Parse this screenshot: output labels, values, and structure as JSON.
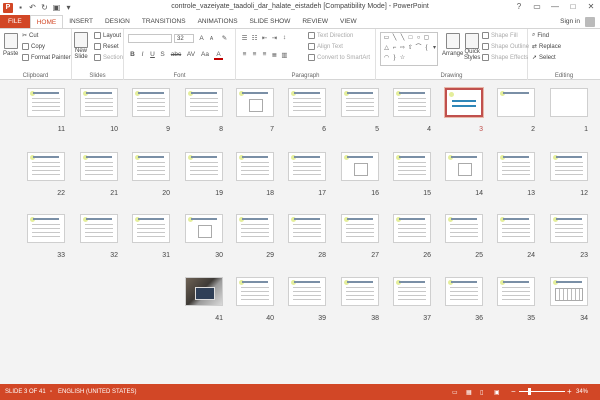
{
  "window": {
    "title": "controle_vazeiyate_taadoli_dar_halate_eistadeh [Compatibility Mode] - PowerPoint",
    "app_icon_letter": "P",
    "controls": [
      "?",
      "▭",
      "—",
      "□",
      "✕"
    ]
  },
  "tabs": [
    "FILE",
    "HOME",
    "INSERT",
    "DESIGN",
    "TRANSITIONS",
    "ANIMATIONS",
    "SLIDE SHOW",
    "REVIEW",
    "VIEW"
  ],
  "active_tab": "HOME",
  "account": {
    "signin": "Sign in"
  },
  "ribbon": {
    "clipboard": {
      "label": "Clipboard",
      "paste": "Paste",
      "cut": "Cut",
      "copy": "Copy",
      "format_painter": "Format Painter"
    },
    "slides": {
      "label": "Slides",
      "new_slide": "New",
      "new_slide_2": "Slide",
      "layout": "Layout",
      "reset": "Reset",
      "section": "Section"
    },
    "font": {
      "label": "Font",
      "font_size": "32",
      "grow": "A",
      "shrink": "A",
      "bold": "B",
      "italic": "I",
      "underline": "U",
      "strike": "S",
      "shadow": "abc",
      "spacing": "AV",
      "case": "Aa",
      "color": "A"
    },
    "paragraph": {
      "label": "Paragraph",
      "text_direction": "Text Direction",
      "align_text": "Align Text",
      "convert_smartart": "Convert to SmartArt"
    },
    "drawing": {
      "label": "Drawing",
      "arrange": "Arrange",
      "quick_styles": "Quick",
      "quick_styles_2": "Styles",
      "shape_fill": "Shape Fill",
      "shape_outline": "Shape Outline",
      "shape_effects": "Shape Effects"
    },
    "editing": {
      "label": "Editing",
      "find": "Find",
      "replace": "Replace",
      "select": "Select"
    }
  },
  "slides": [
    {
      "n": "1",
      "style": "blank"
    },
    {
      "n": "2",
      "style": "title"
    },
    {
      "n": "3",
      "style": "intro",
      "selected": true
    },
    {
      "n": "4",
      "style": "text"
    },
    {
      "n": "5",
      "style": "text"
    },
    {
      "n": "6",
      "style": "text"
    },
    {
      "n": "7",
      "style": "figure"
    },
    {
      "n": "8",
      "style": "text"
    },
    {
      "n": "9",
      "style": "text"
    },
    {
      "n": "10",
      "style": "text"
    },
    {
      "n": "11",
      "style": "text"
    },
    {
      "n": "12",
      "style": "text"
    },
    {
      "n": "13",
      "style": "text"
    },
    {
      "n": "14",
      "style": "figure"
    },
    {
      "n": "15",
      "style": "text"
    },
    {
      "n": "16",
      "style": "figure"
    },
    {
      "n": "17",
      "style": "text"
    },
    {
      "n": "18",
      "style": "text"
    },
    {
      "n": "19",
      "style": "text"
    },
    {
      "n": "20",
      "style": "text"
    },
    {
      "n": "21",
      "style": "text"
    },
    {
      "n": "22",
      "style": "text"
    },
    {
      "n": "23",
      "style": "text"
    },
    {
      "n": "24",
      "style": "text"
    },
    {
      "n": "25",
      "style": "text"
    },
    {
      "n": "26",
      "style": "text"
    },
    {
      "n": "27",
      "style": "text"
    },
    {
      "n": "28",
      "style": "text"
    },
    {
      "n": "29",
      "style": "text"
    },
    {
      "n": "30",
      "style": "figure"
    },
    {
      "n": "31",
      "style": "text"
    },
    {
      "n": "32",
      "style": "text"
    },
    {
      "n": "33",
      "style": "text"
    },
    {
      "n": "34",
      "style": "table"
    },
    {
      "n": "35",
      "style": "text"
    },
    {
      "n": "36",
      "style": "text"
    },
    {
      "n": "37",
      "style": "text"
    },
    {
      "n": "38",
      "style": "text"
    },
    {
      "n": "39",
      "style": "text"
    },
    {
      "n": "40",
      "style": "text"
    },
    {
      "n": "41",
      "style": "photo"
    }
  ],
  "status": {
    "slide_counter": "SLIDE 3 OF 41",
    "language": "ENGLISH (UNITED STATES)",
    "zoom": "34%",
    "zoom_fraction": 0.34
  },
  "colors": {
    "accent": "#d24726",
    "selection": "#c0504d"
  }
}
